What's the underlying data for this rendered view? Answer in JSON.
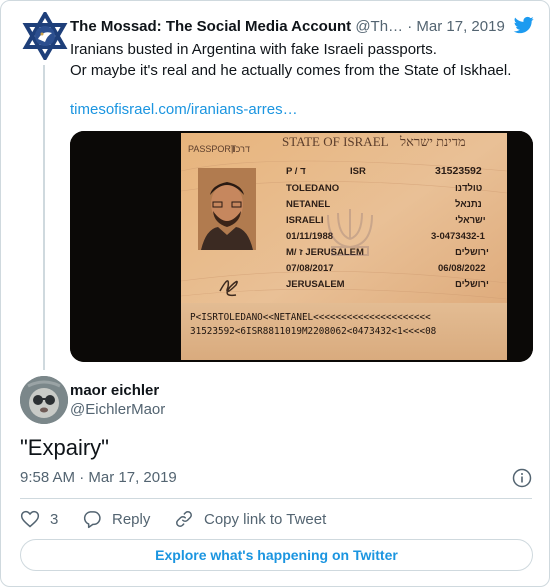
{
  "parent_tweet": {
    "author_name": "The Mossad: The Social Media Account",
    "handle": "@Th…",
    "separator": "·",
    "date": "Mar 17, 2019",
    "text_lines": [
      "Iranians busted in Argentina with fake Israeli passports.",
      "Or maybe it's real and he actually comes from the State of Iskhael."
    ],
    "link": "timesofisrael.com/iranians-arres…",
    "passport": {
      "document_label": "PASSPORT",
      "document_label_he": "דרכון",
      "state_title": "STATE OF ISRAEL",
      "state_title_he": "מדינת ישראל",
      "type": "P / ד",
      "country_code": "ISR",
      "passport_no": "31523592",
      "surname": "TOLEDANO",
      "surname_he": "טולדנו",
      "given_name": "NETANEL",
      "given_name_he": "נתנאל",
      "nationality": "ISRAELI",
      "nationality_he": "ישראלי",
      "date_of_birth": "01/11/1988",
      "id_no": "3-0473432-1",
      "sex_place": "M/ ז  JERUSALEM",
      "place_he": "ירושלים",
      "date_of_issue": "07/08/2017",
      "date_of_expiry": "06/08/2022",
      "authority": "JERUSALEM",
      "authority_he": "ירושלים",
      "mrz_line_1": "P<ISRTOLEDANO<<NETANEL<<<<<<<<<<<<<<<<<<<<<",
      "mrz_line_2": "31523592<6ISR8811019M2208062<0473432<1<<<<08"
    }
  },
  "reply_tweet": {
    "author_name": "maor eichler",
    "handle": "@EichlerMaor",
    "text": "\"Expairy\"",
    "time": "9:58 AM",
    "separator": "·",
    "date": "Mar 17, 2019"
  },
  "actions": {
    "like_count": "3",
    "reply_label": "Reply",
    "copy_link_label": "Copy link to Tweet"
  },
  "explore_label": "Explore what's happening on Twitter",
  "colors": {
    "twitter_blue": "#1d9bf0",
    "link_blue": "#1b95e0",
    "text_primary": "#0f1419",
    "text_secondary": "#536471",
    "border": "#cfd9de"
  },
  "icons": [
    "mossad-logo-icon",
    "twitter-bird-icon",
    "info-icon",
    "heart-icon",
    "reply-icon",
    "link-icon"
  ]
}
